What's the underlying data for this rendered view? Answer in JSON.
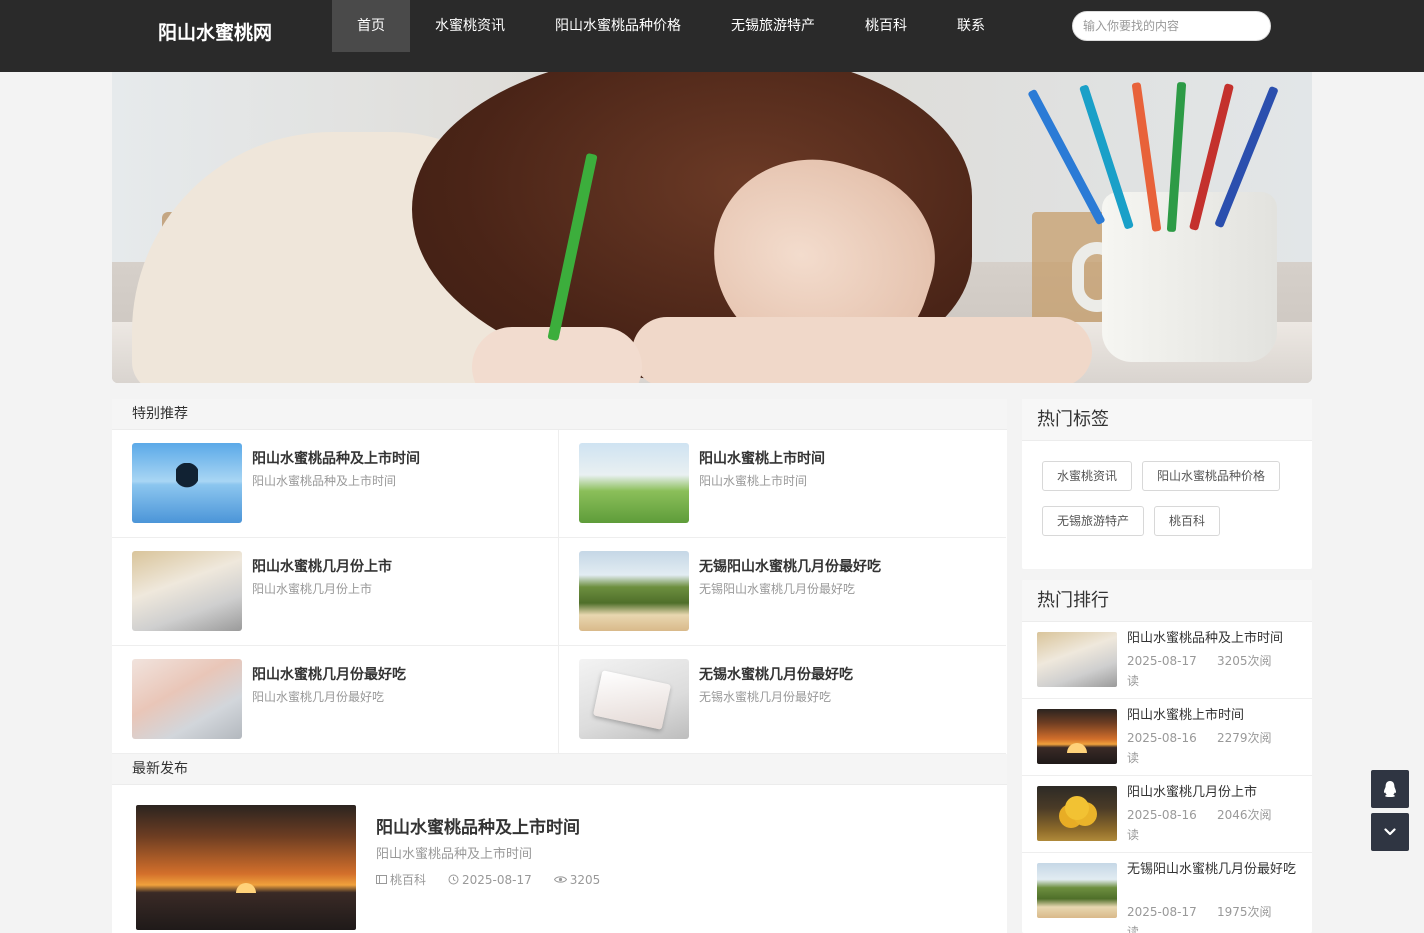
{
  "header": {
    "logo": "阳山水蜜桃网",
    "nav": [
      "首页",
      "水蜜桃资讯",
      "阳山水蜜桃品种价格",
      "无锡旅游特产",
      "桃百科",
      "联系"
    ],
    "search_placeholder": "输入你要找的内容"
  },
  "recommend": {
    "title": "特别推荐",
    "items": [
      {
        "title": "阳山水蜜桃品种及上市时间",
        "sub": "阳山水蜜桃品种及上市时间",
        "icon": "tree-lake-thumb"
      },
      {
        "title": "阳山水蜜桃上市时间",
        "sub": "阳山水蜜桃上市时间",
        "icon": "flower-field-thumb"
      },
      {
        "title": "阳山水蜜桃几月份上市",
        "sub": "阳山水蜜桃几月份上市",
        "icon": "laptop-thumb"
      },
      {
        "title": "无锡阳山水蜜桃几月份最好吃",
        "sub": "无锡阳山水蜜桃几月份最好吃",
        "icon": "peach-hill-thumb"
      },
      {
        "title": "阳山水蜜桃几月份最好吃",
        "sub": "阳山水蜜桃几月份最好吃",
        "icon": "typing-thumb"
      },
      {
        "title": "无锡水蜜桃几月份最好吃",
        "sub": "无锡水蜜桃几月份最好吃",
        "icon": "gift-box-thumb"
      }
    ]
  },
  "latest": {
    "title": "最新发布",
    "item": {
      "title": "阳山水蜜桃品种及上市时间",
      "sub": "阳山水蜜桃品种及上市时间",
      "category": "桃百科",
      "date": "2025-08-17",
      "views": "3205"
    }
  },
  "hot_tags": {
    "title": "热门标签",
    "tags": [
      "水蜜桃资讯",
      "阳山水蜜桃品种价格",
      "无锡旅游特产",
      "桃百科"
    ]
  },
  "hot_rank": {
    "title": "热门排行",
    "items": [
      {
        "title": "阳山水蜜桃品种及上市时间",
        "date": "2025-08-17",
        "views": "3205次阅",
        "unit": "读"
      },
      {
        "title": "阳山水蜜桃上市时间",
        "date": "2025-08-16",
        "views": "2279次阅",
        "unit": "读"
      },
      {
        "title": "阳山水蜜桃几月份上市",
        "date": "2025-08-16",
        "views": "2046次阅",
        "unit": "读"
      },
      {
        "title": "无锡阳山水蜜桃几月份最好吃",
        "date": "2025-08-17",
        "views": "1975次阅",
        "unit": "读"
      }
    ]
  },
  "colors": {
    "header_bg": "#2a2a2a",
    "nav_active": "#4a4a4a",
    "float_btn": "#2f3542"
  }
}
